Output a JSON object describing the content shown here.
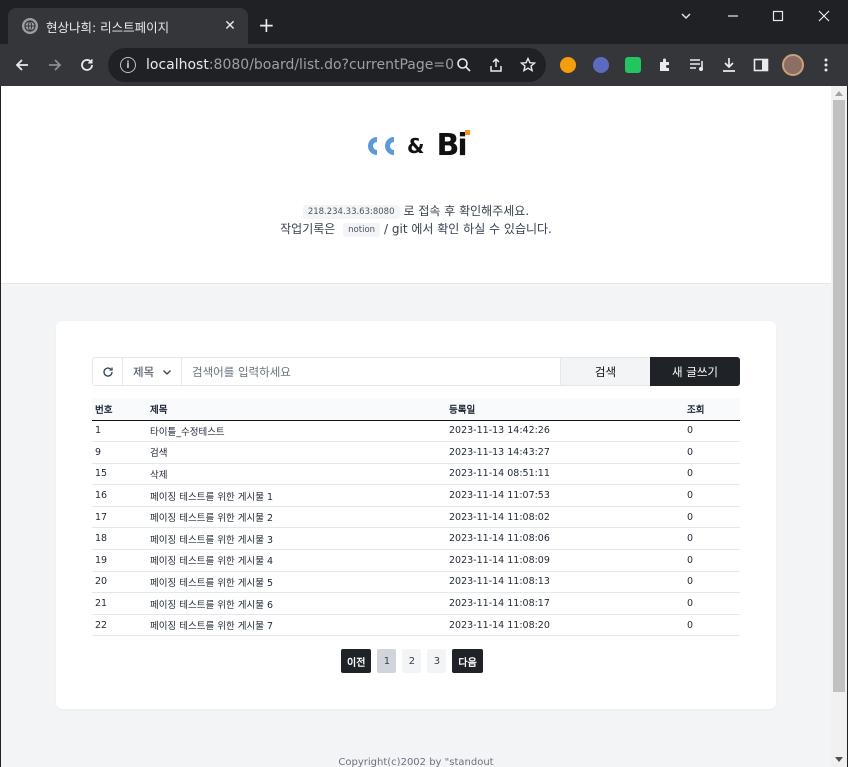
{
  "browser": {
    "tab_title": "현상나희: 리스트페이지",
    "url_host": "localhost",
    "url_rest": ":8080/board/list.do?currentPage=0"
  },
  "header": {
    "logo_left": "ᕦᕦ",
    "logo_amp": "&",
    "logo_right": "Bi",
    "notice_line1_code": "218.234.33.63:8080",
    "notice_line1_text": "로 접속 후 확인해주세요.",
    "notice_line2_prefix": "작업기록은",
    "notice_line2_code": "notion",
    "notice_line2_text": "/ git 에서 확인 하실 수 있습니다.",
    "brand_colors": {
      "blue": "#5b9bd5",
      "orange": "#f7931e"
    }
  },
  "search": {
    "select_value": "제목",
    "placeholder": "검색어를 입력하세요",
    "search_label": "검색",
    "write_label": "새 글쓰기"
  },
  "table": {
    "columns": [
      "번호",
      "제목",
      "등록일",
      "조회"
    ],
    "rows": [
      [
        "1",
        "타이틀_수정테스트",
        "2023-11-13 14:42:26",
        "0"
      ],
      [
        "9",
        "검색",
        "2023-11-13 14:43:27",
        "0"
      ],
      [
        "15",
        "삭제",
        "2023-11-14 08:51:11",
        "0"
      ],
      [
        "16",
        "페이징 테스트를 위한 게시물 1",
        "2023-11-14 11:07:53",
        "0"
      ],
      [
        "17",
        "페이징 테스트를 위한 게시물 2",
        "2023-11-14 11:08:02",
        "0"
      ],
      [
        "18",
        "페이징 테스트를 위한 게시물 3",
        "2023-11-14 11:08:06",
        "0"
      ],
      [
        "19",
        "페이징 테스트를 위한 게시물 4",
        "2023-11-14 11:08:09",
        "0"
      ],
      [
        "20",
        "페이징 테스트를 위한 게시물 5",
        "2023-11-14 11:08:13",
        "0"
      ],
      [
        "21",
        "페이징 테스트를 위한 게시물 6",
        "2023-11-14 11:08:17",
        "0"
      ],
      [
        "22",
        "페이징 테스트를 위한 게시물 7",
        "2023-11-14 11:08:20",
        "0"
      ]
    ]
  },
  "pager": {
    "prev": "이전",
    "pages": [
      "1",
      "2",
      "3"
    ],
    "current": "1",
    "next": "다음"
  },
  "footer": {
    "text": "Copyright(c)2002 by \"standout"
  }
}
